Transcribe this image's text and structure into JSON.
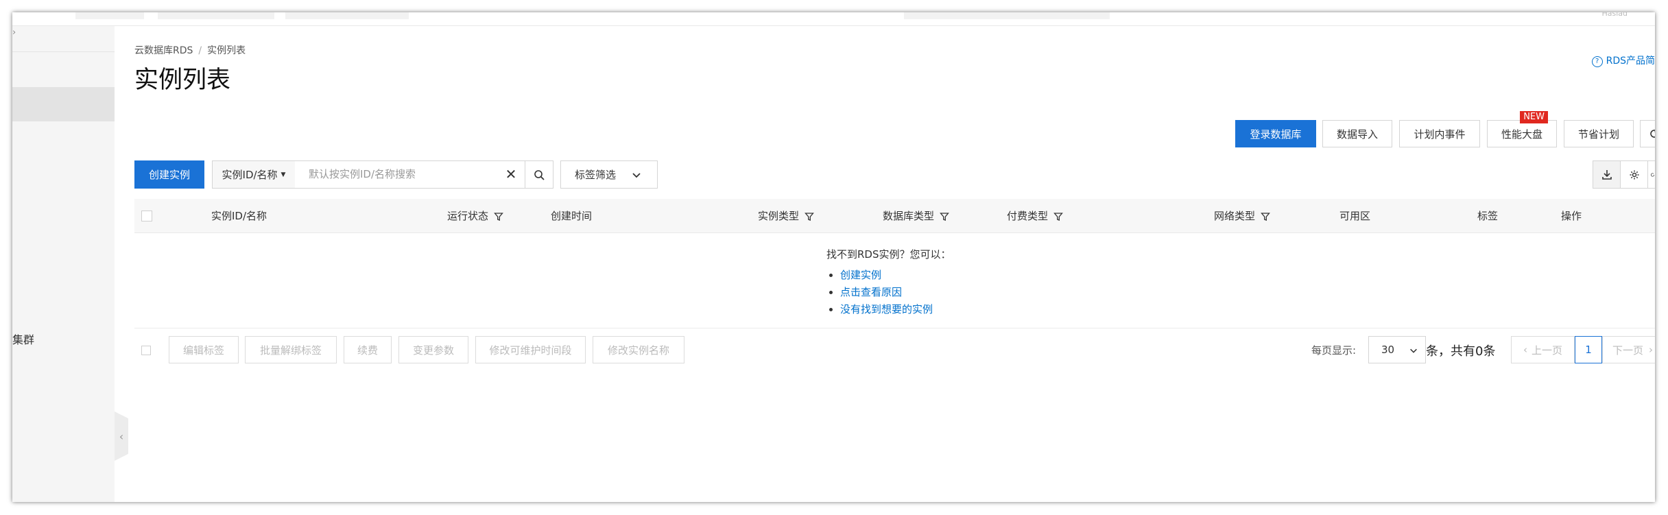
{
  "topbar": {
    "right_text": "Haslad"
  },
  "sidebar": {
    "active_item": "",
    "cluster_label": "集群"
  },
  "breadcrumb": {
    "root": "云数据库RDS",
    "separator": "/",
    "current": "实例列表"
  },
  "page_title": "实例列表",
  "help_link": {
    "icon": "question-circle-icon",
    "label": "RDS产品简"
  },
  "actions": {
    "login_db": "登录数据库",
    "data_import": "数据导入",
    "planned_events": "计划内事件",
    "perf_dashboard": "性能大盘",
    "new_badge": "NEW",
    "savings_plan": "节省计划"
  },
  "toolbar": {
    "create_instance": "创建实例",
    "search_prefix": "实例ID/名称",
    "search_placeholder": "默认按实例ID/名称搜索",
    "clear_glyph": "✕",
    "tag_filter": "标签筛选"
  },
  "table": {
    "columns": [
      "实例ID/名称",
      "运行状态",
      "创建时间",
      "实例类型",
      "数据库类型",
      "付费类型",
      "网络类型",
      "可用区",
      "标签",
      "操作"
    ],
    "filterable": [
      "运行状态",
      "实例类型",
      "数据库类型",
      "付费类型",
      "网络类型"
    ]
  },
  "empty_state": {
    "title": "找不到RDS实例？您可以：",
    "links": [
      "创建实例",
      "点击查看原因",
      "没有找到想要的实例"
    ]
  },
  "bulk_actions": [
    "编辑标签",
    "批量解绑标签",
    "续费",
    "变更参数",
    "修改可维护时间段",
    "修改实例名称"
  ],
  "pagination": {
    "per_page_label": "每页显示:",
    "per_page_value": "30",
    "total_text": "条，共有0条",
    "prev": "上一页",
    "current_page": "1",
    "next": "下一页"
  },
  "colors": {
    "primary": "#1a72d6",
    "link": "#0070cc",
    "badge": "#e0281f"
  }
}
